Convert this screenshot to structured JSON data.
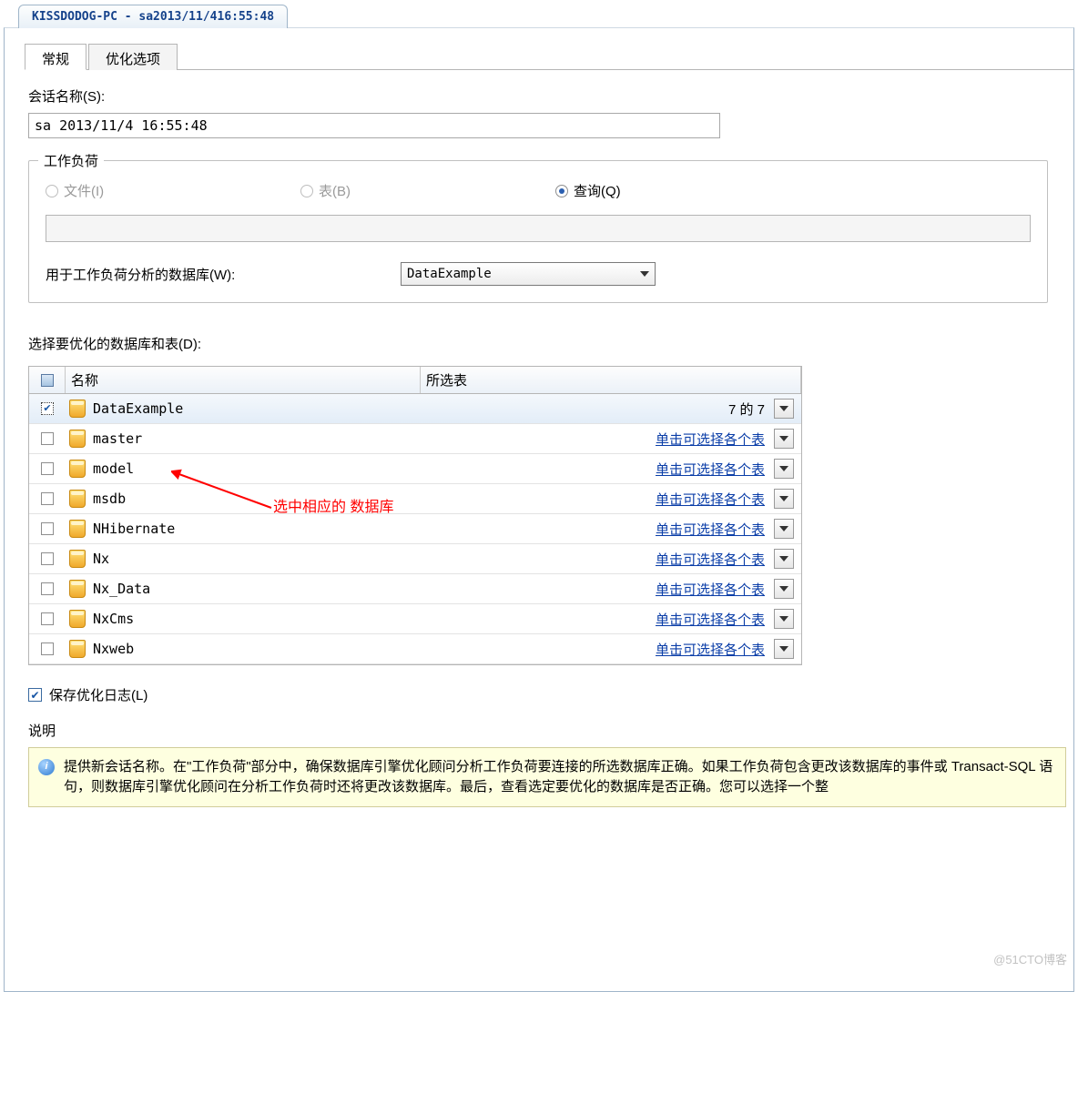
{
  "outerTab": "KISSDODOG-PC - sa2013/11/416:55:48",
  "tabs": {
    "general": "常规",
    "tuning": "优化选项"
  },
  "sessionName": {
    "label": "会话名称(S):",
    "value": "sa 2013/11/4 16:55:48"
  },
  "workload": {
    "legend": "工作负荷",
    "file": "文件(I)",
    "table": "表(B)",
    "query": "查询(Q)",
    "analysisDbLabel": "用于工作负荷分析的数据库(W):",
    "analysisDbValue": "DataExample"
  },
  "dbSection": {
    "label": "选择要优化的数据库和表(D):",
    "headerName": "名称",
    "headerSelected": "所选表",
    "linkText": "单击可选择各个表",
    "selectedCount": "7 的 7",
    "rows": [
      {
        "name": "DataExample",
        "checked": true,
        "selected": true,
        "text": "count"
      },
      {
        "name": "master",
        "checked": false,
        "selected": false,
        "text": "link"
      },
      {
        "name": "model",
        "checked": false,
        "selected": false,
        "text": "link"
      },
      {
        "name": "msdb",
        "checked": false,
        "selected": false,
        "text": "link"
      },
      {
        "name": "NHibernate",
        "checked": false,
        "selected": false,
        "text": "link"
      },
      {
        "name": "Nx",
        "checked": false,
        "selected": false,
        "text": "link"
      },
      {
        "name": "Nx_Data",
        "checked": false,
        "selected": false,
        "text": "link"
      },
      {
        "name": "NxCms",
        "checked": false,
        "selected": false,
        "text": "link"
      },
      {
        "name": "Nxweb",
        "checked": false,
        "selected": false,
        "text": "link"
      }
    ]
  },
  "saveLog": "保存优化日志(L)",
  "description": {
    "label": "说明",
    "text": "提供新会话名称。在\"工作负荷\"部分中，确保数据库引擎优化顾问分析工作负荷要连接的所选数据库正确。如果工作负荷包含更改该数据库的事件或 Transact-SQL 语句，则数据库引擎优化顾问在分析工作负荷时还将更改该数据库。最后，查看选定要优化的数据库是否正确。您可以选择一个整"
  },
  "annotation": "选中相应的\n数据库",
  "watermark": "@51CTO博客"
}
